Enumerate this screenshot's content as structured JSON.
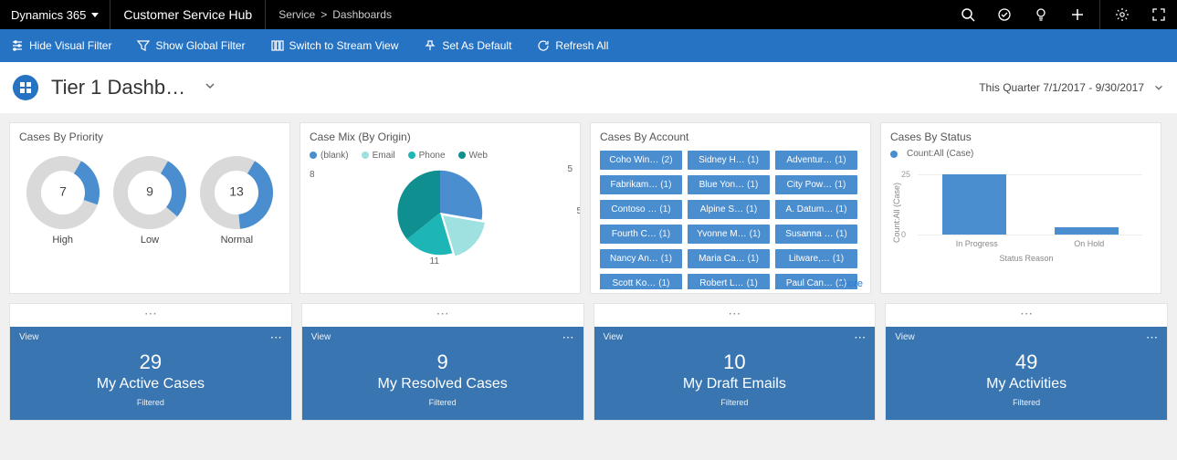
{
  "topbar": {
    "brand": "Dynamics 365",
    "app": "Customer Service Hub",
    "breadcrumb": [
      "Service",
      "Dashboards"
    ]
  },
  "commands": {
    "hide_visual_filter": "Hide Visual Filter",
    "show_global_filter": "Show Global Filter",
    "switch_stream": "Switch to Stream View",
    "set_default": "Set As Default",
    "refresh_all": "Refresh All"
  },
  "dashboard": {
    "title": "Tier 1 Dashb…",
    "date_range": "This Quarter 7/1/2017 - 9/30/2017"
  },
  "cards": {
    "priority": {
      "title": "Cases By Priority",
      "items": [
        {
          "label": "High",
          "value": 7,
          "pct": 0.22
        },
        {
          "label": "Low",
          "value": 9,
          "pct": 0.28
        },
        {
          "label": "Normal",
          "value": 13,
          "pct": 0.4
        }
      ]
    },
    "origin": {
      "title": "Case Mix (By Origin)",
      "legend": [
        "(blank)",
        "Email",
        "Phone",
        "Web"
      ],
      "colors": {
        "blank": "#4b8ed0",
        "email": "#9fe0e0",
        "phone": "#1db5b5",
        "web": "#0f8f8f"
      },
      "labels": {
        "top": "5",
        "right": "5",
        "bottom": "11",
        "left": "8"
      }
    },
    "accounts": {
      "title": "Cases By Account",
      "more": "more",
      "rows": [
        [
          {
            "name": "Coho Win…",
            "count": 2
          },
          {
            "name": "Sidney H…",
            "count": 1
          },
          {
            "name": "Adventur…",
            "count": 1
          }
        ],
        [
          {
            "name": "Fabrikam…",
            "count": 1
          },
          {
            "name": "Blue Yon…",
            "count": 1
          },
          {
            "name": "City Pow…",
            "count": 1
          }
        ],
        [
          {
            "name": "Contoso …",
            "count": 1
          },
          {
            "name": "Alpine S…",
            "count": 1
          },
          {
            "name": "A. Datum…",
            "count": 1
          }
        ],
        [
          {
            "name": "Fourth C…",
            "count": 1
          },
          {
            "name": "Yvonne M…",
            "count": 1
          },
          {
            "name": "Susanna …",
            "count": 1
          }
        ],
        [
          {
            "name": "Nancy An…",
            "count": 1
          },
          {
            "name": "Maria Ca…",
            "count": 1
          },
          {
            "name": "Litware,…",
            "count": 1
          }
        ],
        [
          {
            "name": "Scott Ko…",
            "count": 1
          },
          {
            "name": "Robert L…",
            "count": 1
          },
          {
            "name": "Paul Can…",
            "count": 1
          }
        ]
      ]
    },
    "status": {
      "title": "Cases By Status",
      "legend": "Count:All (Case)",
      "ylabel": "Count:All (Case)",
      "xlabel": "Status Reason",
      "ymax": 30,
      "yticks": [
        0,
        25
      ],
      "bars": [
        {
          "label": "In Progress",
          "value": 25
        },
        {
          "label": "On Hold",
          "value": 3
        }
      ]
    }
  },
  "streams": [
    {
      "count": 29,
      "name": "My Active Cases",
      "sub": "Filtered",
      "view": "View"
    },
    {
      "count": 9,
      "name": "My Resolved Cases",
      "sub": "Filtered",
      "view": "View"
    },
    {
      "count": 10,
      "name": "My Draft Emails",
      "sub": "Filtered",
      "view": "View"
    },
    {
      "count": 49,
      "name": "My Activities",
      "sub": "Filtered",
      "view": "View"
    }
  ],
  "chart_data": [
    {
      "type": "pie",
      "title": "Cases By Priority",
      "series": [
        {
          "name": "High",
          "categories": [
            "filled",
            "rest"
          ],
          "values": [
            7,
            22
          ]
        },
        {
          "name": "Low",
          "categories": [
            "filled",
            "rest"
          ],
          "values": [
            9,
            20
          ]
        },
        {
          "name": "Normal",
          "categories": [
            "filled",
            "rest"
          ],
          "values": [
            13,
            16
          ]
        }
      ]
    },
    {
      "type": "pie",
      "title": "Case Mix (By Origin)",
      "categories": [
        "(blank)",
        "Email",
        "Phone",
        "Web"
      ],
      "values": [
        8,
        5,
        5,
        11
      ]
    },
    {
      "type": "bar",
      "title": "Cases By Status",
      "categories": [
        "In Progress",
        "On Hold"
      ],
      "values": [
        25,
        3
      ],
      "xlabel": "Status Reason",
      "ylabel": "Count:All (Case)",
      "ylim": [
        0,
        30
      ]
    }
  ]
}
